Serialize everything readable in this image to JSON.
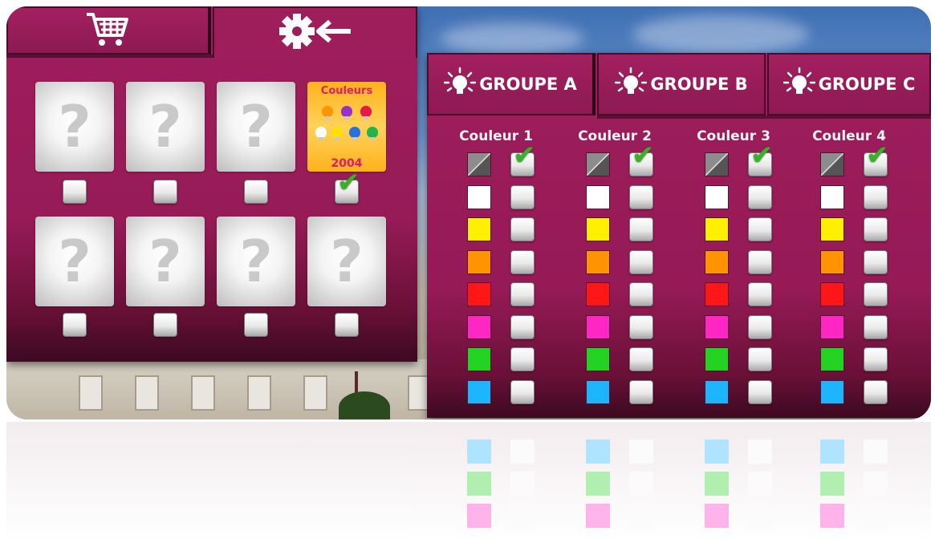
{
  "left_panel": {
    "tabs": [
      {
        "name": "shop",
        "icon": "shopping-cart-icon"
      },
      {
        "name": "settings",
        "icon": "gear-back-arrow-icon"
      }
    ],
    "placeholder_glyph": "?",
    "featured_item": {
      "title": "Couleurs",
      "year": "2004"
    },
    "slots_checked": [
      false,
      false,
      false,
      true,
      false,
      false,
      false,
      false
    ]
  },
  "right_panel": {
    "group_tabs": [
      {
        "label": "GROUPE A",
        "icon": "lightbulb-icon"
      },
      {
        "label": "GROUPE B",
        "icon": "lightbulb-icon"
      },
      {
        "label": "GROUPE C",
        "icon": "lightbulb-icon"
      }
    ],
    "columns": [
      "Couleur 1",
      "Couleur 2",
      "Couleur 3",
      "Couleur 4"
    ],
    "swatch_colors": [
      "none",
      "#ffffff",
      "#ffef00",
      "#ff9400",
      "#ff1616",
      "#ff27c4",
      "#22d421",
      "#1eb5ff"
    ],
    "checked_row_per_column": [
      0,
      0,
      0,
      0
    ]
  },
  "colors": {
    "panel": "#9e1e5c",
    "panel_dark": "#3c0a20",
    "check_green": "#3fae2a"
  }
}
